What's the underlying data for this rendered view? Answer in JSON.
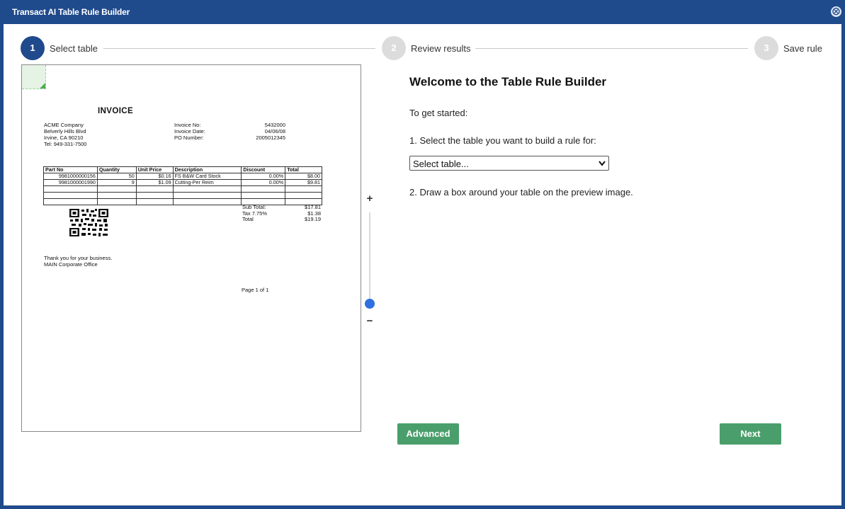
{
  "window": {
    "title": "Transact AI Table Rule Builder",
    "close_icon": "⨂"
  },
  "stepper": [
    {
      "number": "1",
      "label": "Select table",
      "state": "active"
    },
    {
      "number": "2",
      "label": "Review results",
      "state": "inactive"
    },
    {
      "number": "3",
      "label": "Save rule",
      "state": "inactive"
    }
  ],
  "colors": {
    "brand": "#1f4a8c",
    "button": "#4a9e6b",
    "slider": "#2f6fe0"
  },
  "preview": {
    "invoice": {
      "title": "INVOICE",
      "address": [
        "ACME Company",
        "Belverly Hills Blvd",
        "Irvine, CA 90210",
        "Tel: 949-331-7500"
      ],
      "meta_labels": [
        "Invoice No:",
        "Invoice Date:",
        "PO Number:"
      ],
      "meta_values": [
        "5432000",
        "04/06/08",
        "2005012345"
      ],
      "columns": [
        "Part No",
        "Quantity",
        "Unit Price",
        "Description",
        "Discount",
        "Total"
      ],
      "rows": [
        [
          "9981000000156",
          "50",
          "$0.16",
          "FS B&W Card Stock",
          "0.00%",
          "$8.00"
        ],
        [
          "9981000001990",
          "9",
          "$1.09",
          "Cutting-Per Reim",
          "0.00%",
          "$9.81"
        ]
      ],
      "totals_labels": [
        "Sub Total:",
        "Tax 7.75%",
        "Total"
      ],
      "totals_values": [
        "$17.81",
        "$1.38",
        "$19.19"
      ],
      "thanks": [
        "Thank you for your business.",
        "MAIN Corporate Office"
      ],
      "page": "Page 1 of 1"
    },
    "zoom": {
      "plus": "+",
      "minus": "−",
      "level": 0.05
    }
  },
  "main": {
    "heading": "Welcome to the Table Rule Builder",
    "intro": "To get started:",
    "step1": "1. Select the table you want to build a rule for:",
    "select": {
      "value": "Select table...",
      "chevron": "❯"
    },
    "step2": "2. Draw a box around your table on the preview image."
  },
  "buttons": {
    "advanced": "Advanced",
    "next": "Next"
  }
}
